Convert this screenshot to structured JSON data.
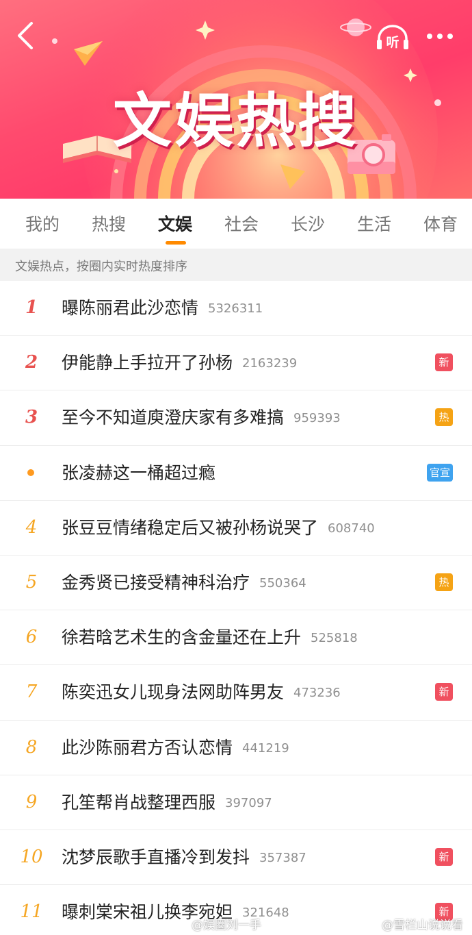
{
  "banner": {
    "title": "文娱热搜",
    "listen_label": "听"
  },
  "tabs": [
    {
      "label": "我的",
      "active": false
    },
    {
      "label": "热搜",
      "active": false
    },
    {
      "label": "文娱",
      "active": true
    },
    {
      "label": "社会",
      "active": false
    },
    {
      "label": "长沙",
      "active": false
    },
    {
      "label": "生活",
      "active": false
    },
    {
      "label": "体育",
      "active": false
    }
  ],
  "subheader": "文娱热点，按圈内实时热度排序",
  "items": [
    {
      "rank": "1",
      "title": "曝陈丽君此沙恋情",
      "count": "5326311",
      "badge": ""
    },
    {
      "rank": "2",
      "title": "伊能静上手拉开了孙杨",
      "count": "2163239",
      "badge": "新"
    },
    {
      "rank": "3",
      "title": "至今不知道庾澄庆家有多难搞",
      "count": "959393",
      "badge": "热"
    },
    {
      "rank": "•",
      "title": "张凌赫这一桶超过瘾",
      "count": "",
      "badge": "官宣"
    },
    {
      "rank": "4",
      "title": "张豆豆情绪稳定后又被孙杨说哭了",
      "count": "608740",
      "badge": ""
    },
    {
      "rank": "5",
      "title": "金秀贤已接受精神科治疗",
      "count": "550364",
      "badge": "热"
    },
    {
      "rank": "6",
      "title": "徐若晗艺术生的含金量还在上升",
      "count": "525818",
      "badge": ""
    },
    {
      "rank": "7",
      "title": "陈奕迅女儿现身法网助阵男友",
      "count": "473236",
      "badge": "新"
    },
    {
      "rank": "8",
      "title": "此沙陈丽君方否认恋情",
      "count": "441219",
      "badge": ""
    },
    {
      "rank": "9",
      "title": "孔笙帮肖战整理西服",
      "count": "397097",
      "badge": ""
    },
    {
      "rank": "10",
      "title": "沈梦辰歌手直播冷到发抖",
      "count": "357387",
      "badge": "新"
    },
    {
      "rank": "11",
      "title": "曝刺棠宋祖儿换李宛妲",
      "count": "321648",
      "badge": "新"
    }
  ],
  "badge_colors": {
    "新": "#f0505f",
    "热": "#f5a315",
    "官宣": "#3fa3ef"
  },
  "watermarks": [
    "@娱圈刘一手",
    "@雪栏山说说看"
  ]
}
